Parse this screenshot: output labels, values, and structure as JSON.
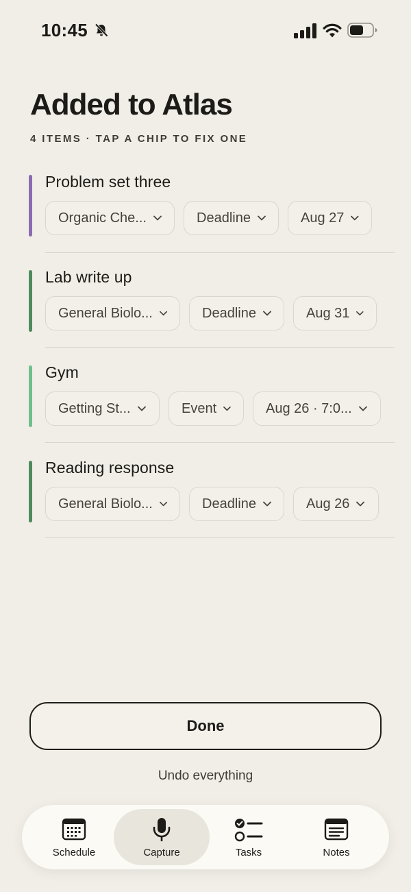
{
  "status_bar": {
    "time": "10:45"
  },
  "header": {
    "title": "Added to Atlas",
    "subtitle": "4 ITEMS · TAP A CHIP TO FIX ONE"
  },
  "items": [
    {
      "title": "Problem set three",
      "accent": "#8b6bb3",
      "course": "Organic Che...",
      "kind": "Deadline",
      "date": "Aug 27"
    },
    {
      "title": "Lab write up",
      "accent": "#4f8a5e",
      "course": "General Biolo...",
      "kind": "Deadline",
      "date": "Aug 31"
    },
    {
      "title": "Gym",
      "accent": "#6fbf8f",
      "course": "Getting St...",
      "kind": "Event",
      "date": "Aug 26 · 7:0..."
    },
    {
      "title": "Reading response",
      "accent": "#4f8a5e",
      "course": "General Biolo...",
      "kind": "Deadline",
      "date": "Aug 26"
    }
  ],
  "actions": {
    "done_label": "Done",
    "undo_label": "Undo everything"
  },
  "tabbar": {
    "tabs": [
      {
        "label": "Schedule",
        "icon": "calendar-icon"
      },
      {
        "label": "Capture",
        "icon": "microphone-icon",
        "active": true
      },
      {
        "label": "Tasks",
        "icon": "checklist-icon"
      },
      {
        "label": "Notes",
        "icon": "note-icon"
      }
    ]
  }
}
